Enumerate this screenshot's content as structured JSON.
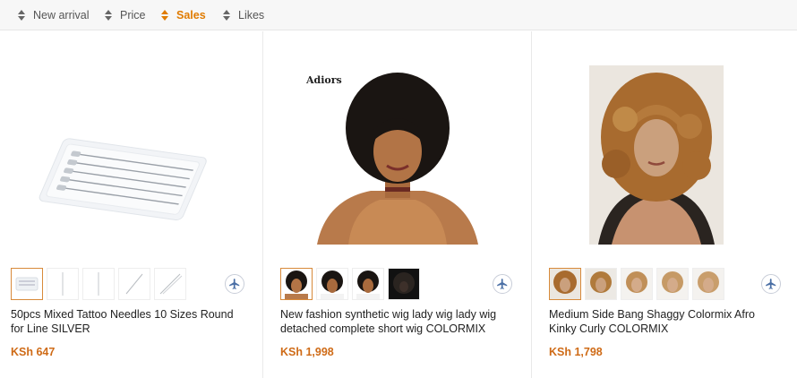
{
  "sort_bar": {
    "options": [
      {
        "label": "New arrival",
        "active": false
      },
      {
        "label": "Price",
        "active": false
      },
      {
        "label": "Sales",
        "active": true
      },
      {
        "label": "Likes",
        "active": false
      }
    ]
  },
  "products": [
    {
      "title": "50pcs Mixed Tattoo Needles 10 Sizes Round for Line SILVER",
      "price": "KSh 647",
      "thumbnail_count": 5,
      "selected_thumbnail": 0,
      "image_icon": "tattoo-needles-icon",
      "ship_icon": "airplane-icon"
    },
    {
      "title": "New fashion synthetic wig lady wig lady wig detached complete short wig COLORMIX",
      "price": "KSh 1,998",
      "thumbnail_count": 4,
      "selected_thumbnail": 0,
      "image_logo_text": "Adiors",
      "image_icon": "afro-wig-model-icon",
      "ship_icon": "airplane-icon"
    },
    {
      "title": "Medium Side Bang Shaggy Colormix Afro Kinky Curly COLORMIX",
      "price": "KSh 1,798",
      "thumbnail_count": 5,
      "selected_thumbnail": 0,
      "image_icon": "curly-wig-model-icon",
      "ship_icon": "airplane-icon"
    }
  ],
  "colors": {
    "accent": "#e07b00",
    "price": "#cf6b17",
    "sortbar_bg": "#f7f7f7"
  }
}
